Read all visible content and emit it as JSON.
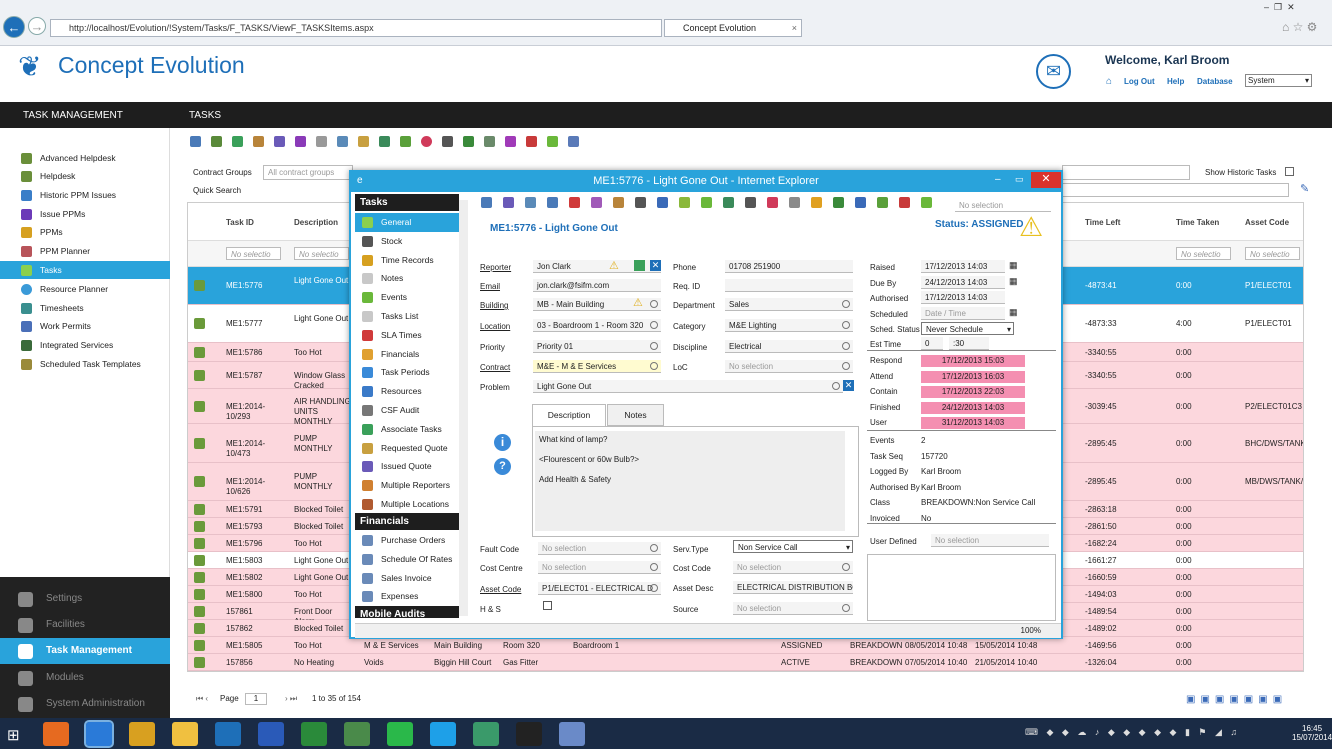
{
  "browser": {
    "url": "http://localhost/Evolution/!System/Tasks/F_TASKS/ViewF_TASKSItems.aspx",
    "tab": "Concept Evolution"
  },
  "app": {
    "brand": "Concept Evolution",
    "welcome": "Welcome, Karl Broom",
    "links": [
      "Log Out",
      "Help",
      "Database"
    ],
    "system": "System"
  },
  "menu": {
    "left": "TASK MANAGEMENT",
    "right": "TASKS"
  },
  "sidebar": {
    "items": [
      "Advanced Helpdesk",
      "Helpdesk",
      "Historic PPM Issues",
      "Issue PPMs",
      "PPMs",
      "PPM Planner",
      "Tasks",
      "Resource Planner",
      "Timesheets",
      "Work Permits",
      "Integrated Services",
      "Scheduled Task Templates"
    ],
    "active": "Tasks",
    "bottom": [
      "Settings",
      "Facilities",
      "Task Management",
      "Modules",
      "System Administration"
    ]
  },
  "filters": {
    "contract_groups_label": "Contract Groups",
    "contract_groups_value": "All contract groups",
    "quick_search": "Quick Search",
    "historic": "Show Historic Tasks"
  },
  "grid": {
    "headers": [
      "Task ID",
      "Description",
      "Time Left",
      "Time Taken",
      "Asset Code"
    ],
    "filter_placeholder": "No selectio",
    "rows": [
      {
        "id": "ME1:5776",
        "desc": "Light Gone Out",
        "left": "-4873:41",
        "taken": "0:00",
        "asset": "P1/ELECT01"
      },
      {
        "id": "ME1:5777",
        "desc": "Light Gone Out",
        "left": "-4873:33",
        "taken": "4:00",
        "asset": "P1/ELECT01"
      },
      {
        "id": "ME1:5786",
        "desc": "Too Hot",
        "left": "-3340:55",
        "taken": "0:00",
        "asset": ""
      },
      {
        "id": "ME1:5787",
        "desc": "Window Glass Cracked",
        "left": "-3340:55",
        "taken": "0:00",
        "asset": ""
      },
      {
        "id": "ME1:2014-10/293",
        "desc": "AIR HANDLING UNITS MONTHLY",
        "left": "-3039:45",
        "taken": "0:00",
        "asset": "P2/ELECT01C3"
      },
      {
        "id": "ME1:2014-10/473",
        "desc": "PUMP MONTHLY",
        "left": "-2895:45",
        "taken": "0:00",
        "asset": "BHC/DWS/TANK..."
      },
      {
        "id": "ME1:2014-10/626",
        "desc": "PUMP MONTHLY",
        "left": "-2895:45",
        "taken": "0:00",
        "asset": "MB/DWS/TANK/..."
      },
      {
        "id": "ME1:5791",
        "desc": "Blocked Toilet",
        "left": "-2863:18",
        "taken": "0:00",
        "asset": ""
      },
      {
        "id": "ME1:5793",
        "desc": "Blocked Toilet",
        "left": "-2861:50",
        "taken": "0:00",
        "asset": ""
      },
      {
        "id": "ME1:5796",
        "desc": "Too Hot",
        "left": "-1682:24",
        "taken": "0:00",
        "asset": ""
      },
      {
        "id": "ME1:5803",
        "desc": "Light Gone Out",
        "left": "-1661:27",
        "taken": "0:00",
        "asset": ""
      },
      {
        "id": "ME1:5802",
        "desc": "Light Gone Out",
        "left": "-1660:59",
        "taken": "0:00",
        "asset": ""
      },
      {
        "id": "ME1:5800",
        "desc": "Too Hot",
        "left": "-1494:03",
        "taken": "0:00",
        "asset": ""
      },
      {
        "id": "157861",
        "desc": "Front Door Alarm",
        "left": "-1489:54",
        "taken": "0:00",
        "asset": ""
      },
      {
        "id": "157862",
        "desc": "Blocked Toilet",
        "left": "-1489:02",
        "taken": "0:00",
        "asset": ""
      },
      {
        "id": "ME1:5805",
        "desc": "Too Hot",
        "extra": [
          "M & E Services",
          "Main Building",
          "Room 320",
          "Boardroom 1",
          "ASSIGNED",
          "BREAKDOWN",
          "08/05/2014 10:48",
          "15/05/2014 10:48"
        ],
        "left": "-1469:56",
        "taken": "0:00",
        "asset": ""
      },
      {
        "id": "157856",
        "desc": "No Heating",
        "extra": [
          "Voids",
          "Biggin Hill Court",
          "Gas Fitter",
          "",
          "ACTIVE",
          "BREAKDOWN",
          "07/05/2014 10:40",
          "21/05/2014 10:40"
        ],
        "left": "-1326:04",
        "taken": "0:00",
        "asset": ""
      }
    ]
  },
  "pager": {
    "label": "Page",
    "page": "1",
    "range": "1 to 35 of 154"
  },
  "popup": {
    "title": "ME1:5776 - Light Gone Out - Internet Explorer",
    "heading": "ME1:5776 - Light Gone Out",
    "status": "Status: ASSIGNED",
    "toolbar_search": "No selection",
    "nav": {
      "tasks_head": "Tasks",
      "tasks": [
        "General",
        "Stock",
        "Time Records",
        "Notes",
        "Events",
        "Tasks List",
        "SLA Times",
        "Financials",
        "Task Periods",
        "Resources",
        "CSF Audit",
        "Associate Tasks",
        "Requested Quote",
        "Issued Quote",
        "Multiple Reporters",
        "Multiple Locations"
      ],
      "fin_head": "Financials",
      "fin": [
        "Purchase Orders",
        "Schedule Of Rates",
        "Sales Invoice",
        "Expenses"
      ],
      "audit_head": "Mobile Audits"
    },
    "fields": {
      "reporter": {
        "label": "Reporter",
        "value": "Jon Clark"
      },
      "email": {
        "label": "Email",
        "value": "jon.clark@fsifm.com"
      },
      "building": {
        "label": "Building",
        "value": "MB - Main Building"
      },
      "location": {
        "label": "Location",
        "value": "03 - Boardroom 1 - Room 320"
      },
      "priority": {
        "label": "Priority",
        "value": "Priority 01"
      },
      "contract": {
        "label": "Contract",
        "value": "M&E - M & E Services"
      },
      "problem": {
        "label": "Problem",
        "value": "Light Gone Out"
      },
      "phone": {
        "label": "Phone",
        "value": "01708 251900"
      },
      "reqid": {
        "label": "Req. ID",
        "value": ""
      },
      "department": {
        "label": "Department",
        "value": "Sales"
      },
      "category": {
        "label": "Category",
        "value": "M&E Lighting"
      },
      "discipline": {
        "label": "Discipline",
        "value": "Electrical"
      },
      "loc": {
        "label": "LoC",
        "value": "No selection"
      },
      "fault": {
        "label": "Fault Code",
        "value": "No selection"
      },
      "cost_centre": {
        "label": "Cost Centre",
        "value": "No selection"
      },
      "asset_code": {
        "label": "Asset Code",
        "value": "P1/ELECT01 - ELECTRICAL D"
      },
      "hs": {
        "label": "H & S"
      },
      "serv": {
        "label": "Serv.Type",
        "value": "Non Service Call"
      },
      "cost_code": {
        "label": "Cost Code",
        "value": "No selection"
      },
      "asset_desc": {
        "label": "Asset Desc",
        "value": "ELECTRICAL DISTRIBUTION BOARI"
      },
      "source": {
        "label": "Source",
        "value": "No selection"
      }
    },
    "tabs": [
      "Description",
      "Notes"
    ],
    "description_lines": [
      "What kind of lamp?",
      "<Flourescent or 60w Bulb?>",
      "Add Health & Safety"
    ],
    "right": {
      "raised": {
        "label": "Raised",
        "value": "17/12/2013 14:03"
      },
      "due": {
        "label": "Due By",
        "value": "24/12/2013 14:03"
      },
      "authorised": {
        "label": "Authorised",
        "value": "17/12/2013 14:03"
      },
      "scheduled": {
        "label": "Scheduled",
        "value": "Date / Time"
      },
      "sched_status": {
        "label": "Sched. Status",
        "value": "Never Schedule"
      },
      "est": {
        "label": "Est Time",
        "h": "0",
        "m": ":30"
      },
      "sla": [
        {
          "label": "Respond",
          "value": "17/12/2013 15:03"
        },
        {
          "label": "Attend",
          "value": "17/12/2013 16:03"
        },
        {
          "label": "Contain",
          "value": "17/12/2013 22:03"
        },
        {
          "label": "Finished",
          "value": "24/12/2013 14:03"
        },
        {
          "label": "User",
          "value": "31/12/2013 14:03"
        }
      ],
      "info": [
        {
          "label": "Events",
          "value": "2"
        },
        {
          "label": "Task Seq",
          "value": "157720"
        },
        {
          "label": "Logged By",
          "value": "Karl Broom"
        },
        {
          "label": "Authorised By",
          "value": "Karl Broom"
        },
        {
          "label": "Class",
          "value": "BREAKDOWN:Non Service Call"
        },
        {
          "label": "Invoiced",
          "value": "No"
        }
      ],
      "user_defined": {
        "label": "User Defined",
        "value": "No selection"
      }
    },
    "zoom": "100%"
  },
  "clock": {
    "time": "16:45",
    "date": "15/07/2014"
  }
}
